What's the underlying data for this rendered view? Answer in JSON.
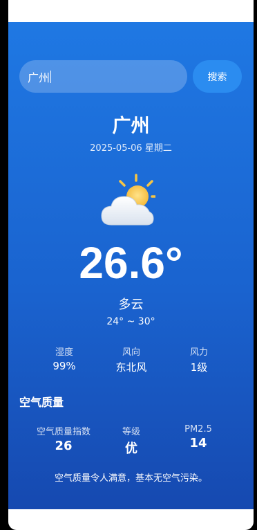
{
  "search": {
    "value": "广州",
    "button_label": "搜索"
  },
  "location": {
    "city": "广州",
    "date": "2025-05-06 星期二"
  },
  "current": {
    "icon": "partly-cloudy-icon",
    "temperature": "26.6°",
    "condition": "多云",
    "range": "24° ~ 30°"
  },
  "details": [
    {
      "label": "湿度",
      "value": "99%"
    },
    {
      "label": "风向",
      "value": "东北风"
    },
    {
      "label": "风力",
      "value": "1级"
    }
  ],
  "air_quality": {
    "title": "空气质量",
    "items": [
      {
        "label": "空气质量指数",
        "value": "26"
      },
      {
        "label": "等级",
        "value": "优"
      },
      {
        "label": "PM2.5",
        "value": "14"
      }
    ],
    "description": "空气质量令人满意，基本无空气污染。"
  },
  "colors": {
    "gradient_top": "#1f78e3",
    "gradient_bottom": "#1649b0",
    "button": "#2b8cf0"
  }
}
